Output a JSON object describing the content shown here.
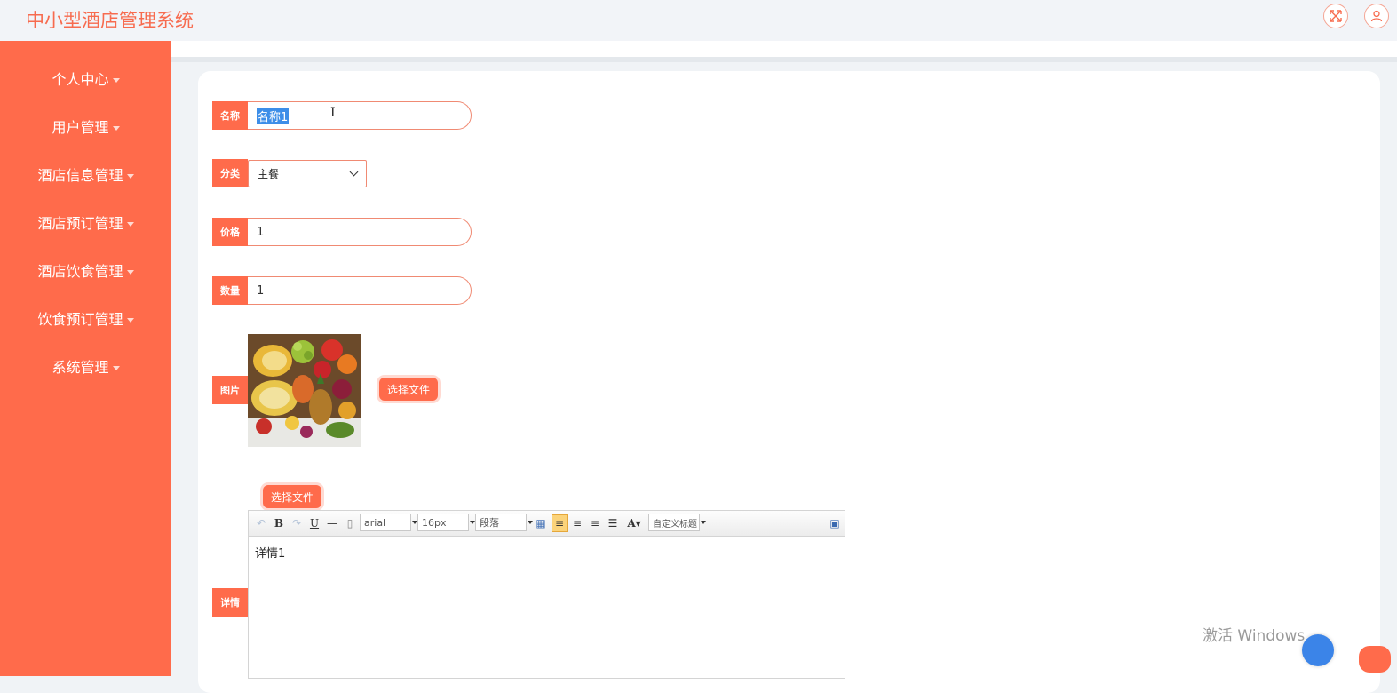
{
  "app": {
    "title": "中小型酒店管理系统"
  },
  "header": {
    "icons": [
      "fullscreen-icon",
      "user-icon"
    ]
  },
  "sidebar": {
    "items": [
      {
        "label": "个人中心"
      },
      {
        "label": "用户管理"
      },
      {
        "label": "酒店信息管理"
      },
      {
        "label": "酒店预订管理"
      },
      {
        "label": "酒店饮食管理"
      },
      {
        "label": "饮食预订管理"
      },
      {
        "label": "系统管理"
      }
    ]
  },
  "form": {
    "name": {
      "label": "名称",
      "value": "名称1"
    },
    "category": {
      "label": "分类",
      "value": "主餐"
    },
    "price": {
      "label": "价格",
      "value": "1"
    },
    "quantity": {
      "label": "数量",
      "value": "1"
    },
    "image": {
      "label": "图片",
      "button": "选择文件"
    },
    "detail": {
      "label": "详情",
      "button": "选择文件",
      "content": "详情1"
    }
  },
  "editor": {
    "font": "arial",
    "size": "16px",
    "paragraph": "段落",
    "custom_title": "自定义标题"
  },
  "os": {
    "watermark": "激活 Windows"
  },
  "colors": {
    "accent": "#ff6b4b",
    "title": "#f76b4f"
  }
}
